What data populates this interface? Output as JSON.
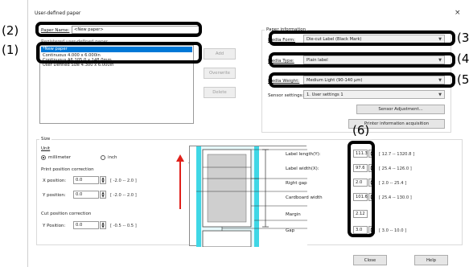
{
  "window": {
    "title": "User-defined paper",
    "close_glyph": "×"
  },
  "callouts": [
    "(2)",
    "(1)",
    "(3)",
    "(4)",
    "(5)",
    "(6)"
  ],
  "paper_name": {
    "label": "Paper Name:",
    "value": "<New paper>"
  },
  "paper_list": {
    "header": "Registered user-defined paper",
    "items": [
      "*New paper",
      "Continuous 4.000 x 6.000in",
      "Continuous A6 105.0 x 148.0mm",
      "User Defined Size 4.300 x 6.000in"
    ],
    "selected_index": 0
  },
  "list_buttons": {
    "add": "Add",
    "overwrite": "Overwrite",
    "delete": "Delete"
  },
  "paper_information": {
    "title": "Paper information",
    "media_form_label": "Media Form:",
    "media_form_value": "Die-cut Label (Black Mark)",
    "media_type_label": "Media Type:",
    "media_type_value": "Plain label",
    "media_weight_label": "Media Weight:",
    "media_weight_value": "Medium Light (90-140 µm)",
    "sensor_settings_label": "Sensor settings:",
    "sensor_settings_value": "1. User settings 1",
    "sensor_adjustment_button": "Sensor Adjustment...",
    "printer_info_button": "Printer information acquisition"
  },
  "size": {
    "title": "Size",
    "unit_label": "Unit",
    "unit_options": [
      "millimeter",
      "inch"
    ],
    "unit_selected": "millimeter"
  },
  "print_position": {
    "title": "Print position correction",
    "x_label": "X position:",
    "x_value": "0.0",
    "x_range": "[ -2.0  --  2.0  ]",
    "y_label": "Y position:",
    "y_value": "0.0",
    "y_range": "[ -2.0  --  2.0  ]"
  },
  "cut_position": {
    "title": "Cut position correction",
    "y_label": "Y Position:",
    "y_value": "0.0",
    "y_range": "[ -0.5  --  0.5  ]"
  },
  "feed_direction": "Paper Feed Direction",
  "dimensions": [
    {
      "label": "Label length(Y):",
      "value": "111.3",
      "range": "[  12.7   --  1320.8  ]"
    },
    {
      "label": "Label width(X):",
      "value": "97.6",
      "range": "[  25.4   --   126.0  ]"
    },
    {
      "label": "Right gap",
      "value": "2.0",
      "range": "[  2.0    --   25.4   ]"
    },
    {
      "label": "Cardboard width",
      "value": "101.6",
      "range": "[  25.4   --   130.0  ]"
    },
    {
      "label": "Margin",
      "value": "2.12",
      "range": ""
    },
    {
      "label": "Gap",
      "value": "3.0",
      "range": "[  3.0    --   10.0   ]"
    }
  ],
  "footer": {
    "close": "Close",
    "help": "Help"
  },
  "colors": {
    "selection": "#0078d7",
    "diagram_cyan": "#3fd7e6",
    "arrow": "#e0201a"
  }
}
